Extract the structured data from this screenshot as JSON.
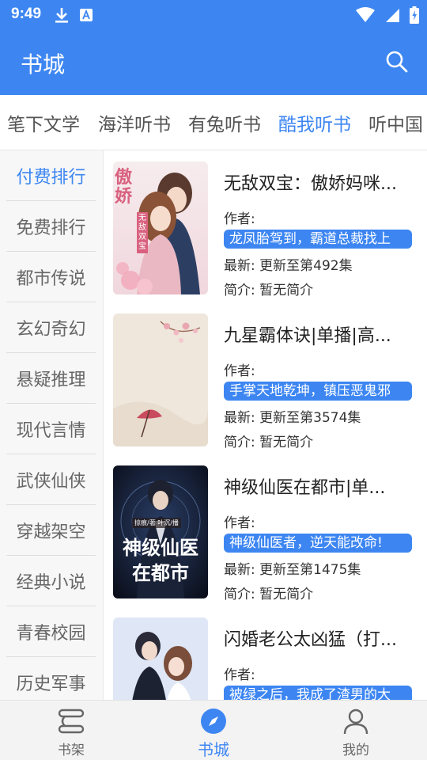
{
  "status_bar": {
    "time": "9:49"
  },
  "header": {
    "title": "书城"
  },
  "top_tabs": [
    {
      "label": "笔下文学",
      "active": false
    },
    {
      "label": "海洋听书",
      "active": false
    },
    {
      "label": "有兔听书",
      "active": false
    },
    {
      "label": "酷我听书",
      "active": true
    },
    {
      "label": "听中国",
      "active": false
    }
  ],
  "side_menu": [
    {
      "label": "付费排行",
      "active": true
    },
    {
      "label": "免费排行",
      "active": false
    },
    {
      "label": "都市传说",
      "active": false
    },
    {
      "label": "玄幻奇幻",
      "active": false
    },
    {
      "label": "悬疑推理",
      "active": false
    },
    {
      "label": "现代言情",
      "active": false
    },
    {
      "label": "武侠仙侠",
      "active": false
    },
    {
      "label": "穿越架空",
      "active": false
    },
    {
      "label": "经典小说",
      "active": false
    },
    {
      "label": "青春校园",
      "active": false
    },
    {
      "label": "历史军事",
      "active": false
    }
  ],
  "books": [
    {
      "title": "无敌双宝：傲娇妈咪...",
      "author": "作者:",
      "tag": "龙凤胎驾到，霸道总裁找上",
      "latest": "最新: 更新至第492集",
      "intro": "简介: 暂无简介",
      "cover_text": "傲娇",
      "cover_sub": "无敌双宝",
      "colors": {
        "accent": "#d9617f"
      }
    },
    {
      "title": "九星霸体诀|单播|高...",
      "author": "作者:",
      "tag": "手掌天地乾坤，镇压恶鬼邪",
      "latest": "最新: 更新至第3574集",
      "intro": "简介: 暂无简介",
      "colors": {
        "accent": "#c94b5e"
      }
    },
    {
      "title": "神级仙医在都市|单...",
      "author": "作者:",
      "tag": "神级仙医者，逆天能改命!",
      "latest": "最新: 更新至第1475集",
      "intro": "简介: 暂无简介",
      "cover_text": "神级仙医",
      "cover_sub": "在都市",
      "cover_credit": "掠痕/著 叶沉/播",
      "colors": {
        "accent": "#2c4b8c"
      }
    },
    {
      "title": "闪婚老公太凶猛（打...",
      "author": "作者:",
      "tag": "被绿之后，我成了渣男的大",
      "latest": "",
      "intro": "",
      "colors": {
        "accent": "#7f9cd6"
      }
    }
  ],
  "bottom_nav": [
    {
      "label": "书架",
      "icon": "bookshelf-icon",
      "active": false
    },
    {
      "label": "书城",
      "icon": "compass-icon",
      "active": true
    },
    {
      "label": "我的",
      "icon": "person-icon",
      "active": false
    }
  ],
  "colors": {
    "primary": "#3d86f2",
    "text": "#333333",
    "muted": "#666666"
  }
}
